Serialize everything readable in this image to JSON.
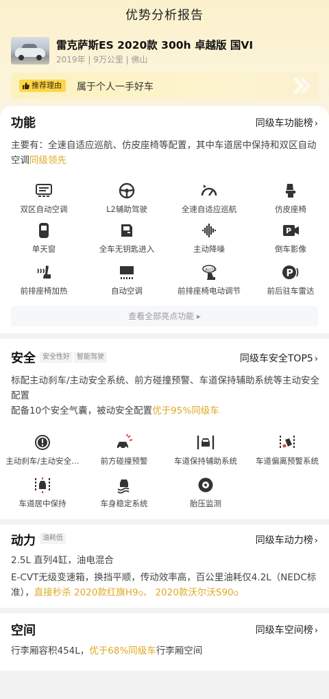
{
  "page": {
    "title": "优势分析报告"
  },
  "car": {
    "title": "雷克萨斯ES 2020款 300h 卓越版 国VI",
    "meta": "2019年 | 9万公里 | 佛山"
  },
  "reason": {
    "tag": "推荐理由",
    "text": "属于个人一手好车"
  },
  "features": {
    "title": "功能",
    "rank_link": "同级车功能榜",
    "desc_main": "主要有：全速自适应巡航、仿皮座椅等配置，其中车道居中保持和双区自动空调",
    "desc_highlight": "同级领先",
    "items": [
      {
        "label": "双区自动空调",
        "icon": "dual-zone-ac-icon"
      },
      {
        "label": "L2辅助驾驶",
        "icon": "steering-wheel-icon"
      },
      {
        "label": "全速自适应巡航",
        "icon": "cruise-gauge-icon"
      },
      {
        "label": "仿皮座椅",
        "icon": "seat-icon"
      },
      {
        "label": "单天窗",
        "icon": "sunroof-icon"
      },
      {
        "label": "全车无钥匙进入",
        "icon": "keyless-door-icon"
      },
      {
        "label": "主动降噪",
        "icon": "sound-wave-icon"
      },
      {
        "label": "倒车影像",
        "icon": "reverse-camera-icon"
      },
      {
        "label": "前排座椅加热",
        "icon": "seat-heating-icon"
      },
      {
        "label": "自动空调",
        "icon": "auto-ac-icon"
      },
      {
        "label": "前排座椅电动调节",
        "icon": "auto-seat-adjust-icon"
      },
      {
        "label": "前后驻车雷达",
        "icon": "parking-radar-icon"
      }
    ],
    "view_all": "查看全部亮点功能"
  },
  "safety": {
    "title": "安全",
    "chips": [
      "安全性好",
      "智能驾驶"
    ],
    "rank_link": "同级车安全TOP5",
    "desc1": "标配主动刹车/主动安全系统、前方碰撞预警、车道保持辅助系统等主动安全配置",
    "desc2_prefix": "配备10个安全气囊，被动安全配置",
    "desc2_highlight": "优于95%同级车",
    "items": [
      {
        "label": "主动刹车/主动安全…",
        "icon": "active-brake-icon"
      },
      {
        "label": "前方碰撞预警",
        "icon": "collision-warning-icon"
      },
      {
        "label": "车道保持辅助系统",
        "icon": "lane-keep-icon"
      },
      {
        "label": "车道偏离预警系统",
        "icon": "lane-departure-icon"
      },
      {
        "label": "车道居中保持",
        "icon": "lane-center-icon"
      },
      {
        "label": "车身稳定系统",
        "icon": "stability-icon"
      },
      {
        "label": "胎压监测",
        "icon": "tire-pressure-icon"
      }
    ]
  },
  "power": {
    "title": "动力",
    "chip": "油耗低",
    "rank_link": "同级车动力榜",
    "line1": "2.5L 直列4缸，油电混合",
    "line2_prefix": "E-CVT无级变速箱，换挡平顺，传动效率高，百公里油耗仅4.2L（NEDC标准），",
    "line2_highlight": "直接秒杀",
    "link1": "2020款红旗H9",
    "sep": "、",
    "link2": "2020款沃尔沃S90"
  },
  "space": {
    "title": "空间",
    "rank_link": "同级车空间榜",
    "line_prefix": "行李厢容积454L，",
    "line_highlight": "优于68%同级车",
    "line_suffix": "行李厢空间"
  },
  "colors": {
    "accent": "#e0a825",
    "tag_yellow": "#fbd64a",
    "header_bg": "#fbf1cc"
  }
}
